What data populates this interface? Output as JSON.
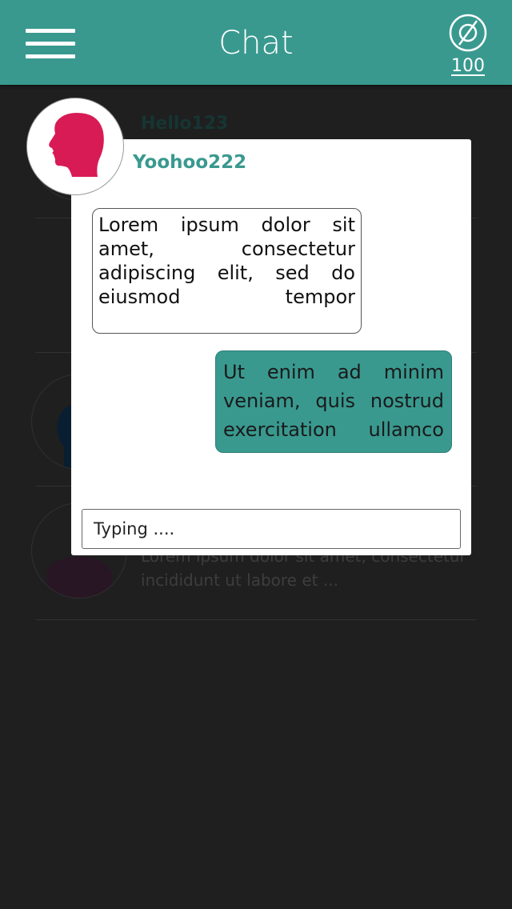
{
  "header": {
    "title": "Chat",
    "coin_count": "100",
    "menu_icon": "hamburger-menu-icon",
    "coin_icon": "empty-set-icon"
  },
  "chat_list": [
    {
      "name": "Hello123",
      "preview": ""
    },
    {
      "name": "",
      "preview": ""
    },
    {
      "name": "",
      "preview": ""
    },
    {
      "name": "",
      "preview": "Lorem ipsum dolor sit amet, consectetur incididunt ut labore et ..."
    }
  ],
  "modal": {
    "contact_name": "Yoohoo222",
    "messages": [
      {
        "direction": "incoming",
        "text": "Lorem ipsum dolor sit amet, consectetur adipiscing elit, sed do eiusmod tempor"
      },
      {
        "direction": "outgoing",
        "text": "Ut enim ad minim veniam, quis nostrud exercitation ullamco"
      }
    ],
    "input": {
      "placeholder": "Typing ...."
    }
  },
  "colors": {
    "accent": "#39998f",
    "background": "#2b2b2b",
    "avatar_red": "#d81b55",
    "avatar_navy": "#0f2a44",
    "avatar_plum": "#3a1f33"
  }
}
